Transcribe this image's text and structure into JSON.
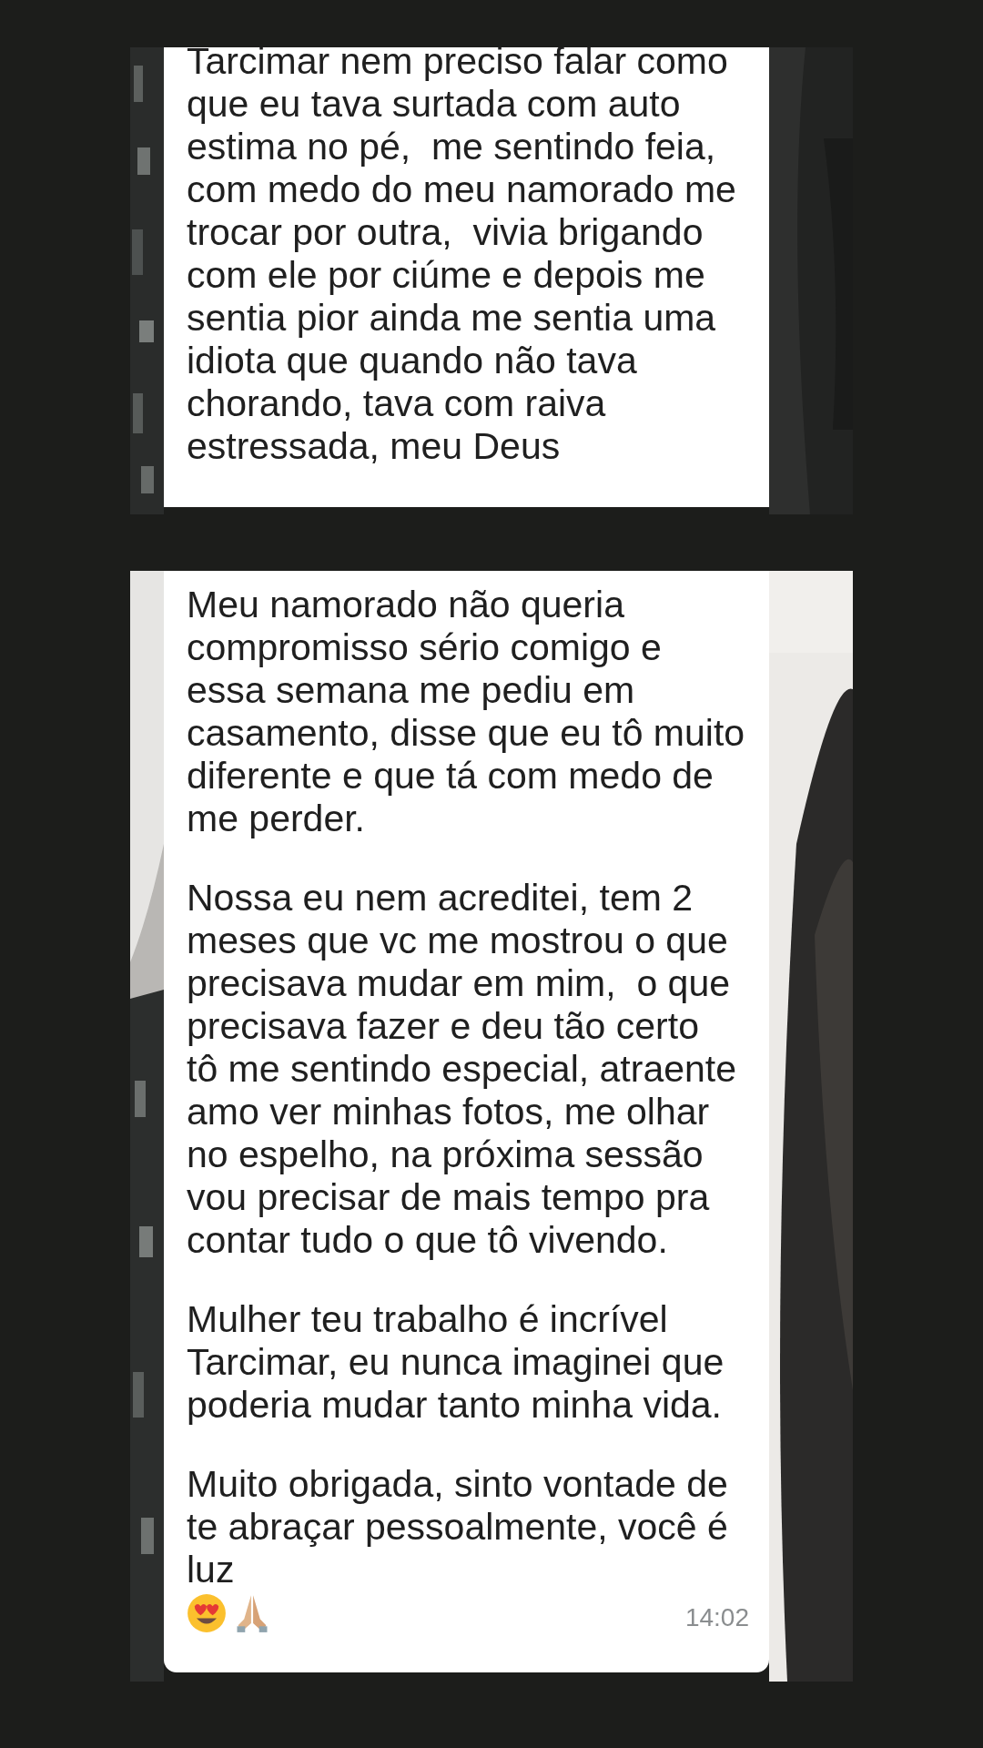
{
  "messages": [
    {
      "paragraphs": [
        "Tarcimar nem preciso falar como que eu tava surtada com auto estima no pé,  me sentindo feia, com medo do meu namorado me trocar por outra,  vivia brigando com ele por ciúme e depois me sentia pior ainda me sentia uma idiota que quando não tava chorando, tava com raiva estressada, meu Deus"
      ]
    },
    {
      "paragraphs": [
        "Meu namorado não queria compromisso sério comigo e essa semana me pediu em casamento, disse que eu tô muito diferente e que tá com medo de me perder.",
        "Nossa eu nem acreditei, tem 2 meses que vc me mostrou o que precisava mudar em mim,  o que precisava fazer e deu tão certo  tô me sentindo especial, atraente amo ver minhas fotos, me olhar no espelho, na próxima sessão vou precisar de mais tempo pra contar tudo o que tô vivendo.",
        "Mulher teu trabalho é incrível Tarcimar, eu nunca imaginei que poderia mudar tanto minha vida.",
        "Muito obrigada, sinto vontade de te abraçar pessoalmente, você é luz"
      ],
      "time": "14:02"
    }
  ]
}
